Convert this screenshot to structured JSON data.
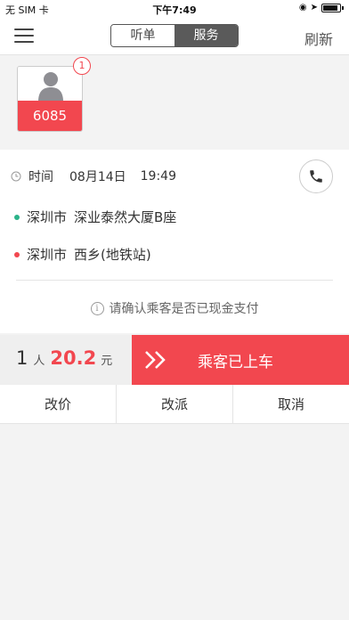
{
  "status_bar": {
    "carrier": "无 SIM 卡",
    "time": "下午7:49"
  },
  "nav": {
    "menu_icon": "hamburger-menu-icon",
    "tabs": [
      {
        "label": "听单",
        "active": false
      },
      {
        "label": "服务",
        "active": true
      }
    ],
    "refresh_label": "刷新"
  },
  "passenger": {
    "code": "6085",
    "badge_count": "1",
    "avatar_icon": "person-avatar-icon"
  },
  "trip": {
    "time_label": "时间",
    "date": "08月14日",
    "time": "19:49",
    "from_city": "深圳市",
    "from_address": "深业泰然大厦B座",
    "to_city": "深圳市",
    "to_address": "西乡(地铁站)",
    "notice": "请确认乘客是否已现金支付"
  },
  "fare": {
    "count": "1",
    "unit": "人",
    "amount": "20.2",
    "currency": "元"
  },
  "board_button": {
    "label": "乘客已上车"
  },
  "actions": [
    {
      "label": "改价"
    },
    {
      "label": "改派"
    },
    {
      "label": "取消"
    }
  ],
  "colors": {
    "accent": "#f2474f",
    "from_dot": "#2bb389",
    "to_dot": "#f2474f"
  }
}
